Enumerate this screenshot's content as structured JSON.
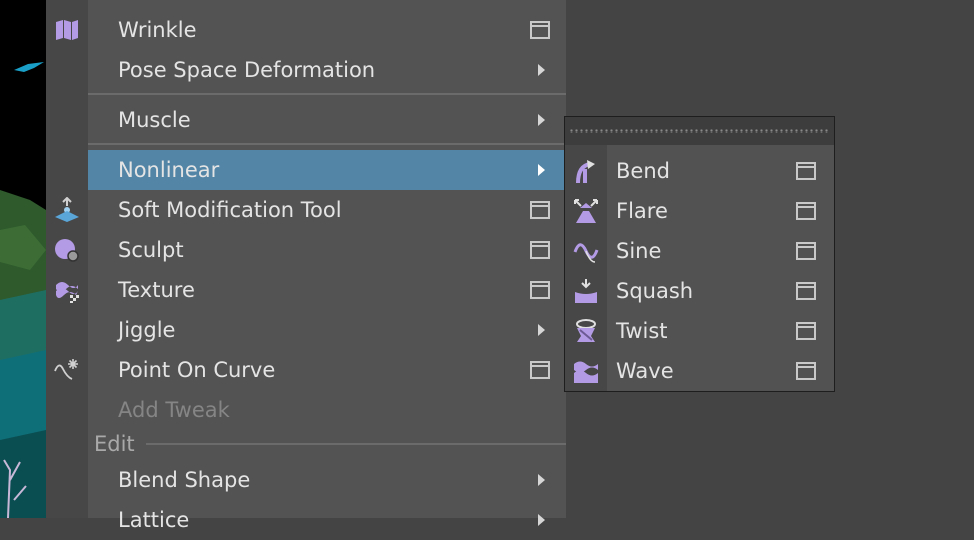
{
  "main_menu": {
    "items": [
      {
        "label": "Wrinkle",
        "icon": "wrinkle-icon",
        "has_option_box": true
      },
      {
        "label": "Pose Space Deformation",
        "has_submenu": true
      },
      {
        "label": "Muscle",
        "has_submenu": true
      },
      {
        "label": "Nonlinear",
        "has_submenu": true,
        "selected": true
      },
      {
        "label": "Soft Modification Tool",
        "icon": "soft-modification-icon",
        "has_option_box": true
      },
      {
        "label": "Sculpt",
        "icon": "sculpt-icon",
        "has_option_box": true
      },
      {
        "label": "Texture",
        "icon": "texture-deformer-icon",
        "has_option_box": true
      },
      {
        "label": "Jiggle",
        "has_submenu": true
      },
      {
        "label": "Point On Curve",
        "icon": "point-on-curve-icon",
        "has_option_box": true
      },
      {
        "label": "Add Tweak",
        "disabled": true
      },
      {
        "label": "Blend Shape",
        "has_submenu": true
      },
      {
        "label": "Lattice",
        "has_submenu": true
      }
    ],
    "section_edit": "Edit"
  },
  "nonlinear_submenu": {
    "items": [
      {
        "label": "Bend",
        "icon": "bend-icon"
      },
      {
        "label": "Flare",
        "icon": "flare-icon"
      },
      {
        "label": "Sine",
        "icon": "sine-icon"
      },
      {
        "label": "Squash",
        "icon": "squash-icon"
      },
      {
        "label": "Twist",
        "icon": "twist-icon"
      },
      {
        "label": "Wave",
        "icon": "wave-icon"
      }
    ]
  },
  "colors": {
    "menu_bg": "#535353",
    "selected_bg": "#5285a6",
    "icon_accent": "#b49be6",
    "disabled_text": "#858585"
  }
}
